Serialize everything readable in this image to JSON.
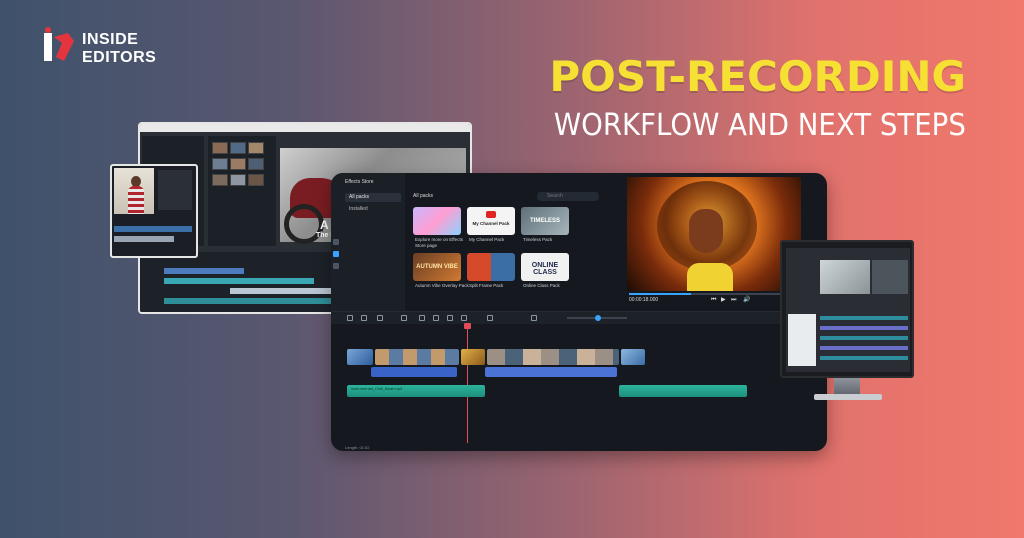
{
  "logo": {
    "line1": "INSIDE",
    "line2": "EDITORS"
  },
  "headline": {
    "line1": "POST-RECORDING",
    "line2": "WORKFLOW AND NEXT STEPS"
  },
  "colors": {
    "headline_accent": "#f6e033",
    "headline_secondary": "#ffffff",
    "logo_mark_red": "#e4353e",
    "bg_left": "#3f526b",
    "bg_right": "#f0786c"
  },
  "back_editor": {
    "caption_a": "A B",
    "caption_b": "The Beautiful"
  },
  "main_editor": {
    "store_title": "Effects Store",
    "categories": [
      "All packs",
      "Installed"
    ],
    "packs_header": "All packs",
    "search_placeholder": "Search",
    "cards": [
      {
        "label": "Explore more on Effects Store page",
        "text": ""
      },
      {
        "label": "My Channel Pack",
        "text": "My Channel Pack"
      },
      {
        "label": "Timeless Pack",
        "text": "TIMELESS"
      },
      {
        "label": "Autumn Vibe Overlay Pack",
        "text": "AUTUMN VIBE"
      },
      {
        "label": "Split Frame Pack",
        "text": ""
      },
      {
        "label": "Online Class Pack",
        "text": "ONLINE CLASS"
      }
    ],
    "timecode": "00:00:18.000",
    "audio_clip_label": "instrumental_Chill_Beat.mp3",
    "length_label": "Length: 01:02"
  }
}
